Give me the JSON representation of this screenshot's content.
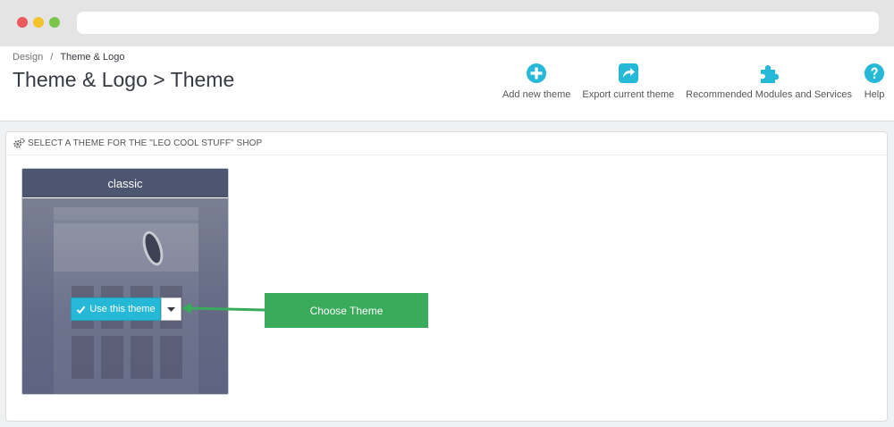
{
  "breadcrumb": {
    "parent": "Design",
    "separator": "/",
    "current": "Theme & Logo"
  },
  "page_title": "Theme & Logo > Theme",
  "toolbar": [
    {
      "label": "Add new theme",
      "icon": "plus-circle-icon"
    },
    {
      "label": "Export current theme",
      "icon": "share-square-icon"
    },
    {
      "label": "Recommended Modules and Services",
      "icon": "puzzle-icon"
    },
    {
      "label": "Help",
      "icon": "help-circle-icon"
    }
  ],
  "panel": {
    "heading": "Select a theme for the \"Leo Cool Stuff\" shop",
    "icon": "cogs-icon"
  },
  "theme": {
    "name": "classic",
    "use_button_label": "Use this theme"
  },
  "annotation": {
    "label": "Choose Theme"
  },
  "colors": {
    "accent": "#25b9d7",
    "annotation_green": "#3aaa5b",
    "theme_header": "#4d5670"
  }
}
